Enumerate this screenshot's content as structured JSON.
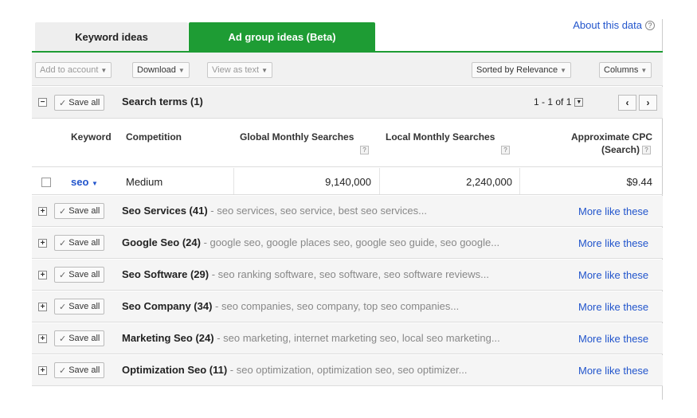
{
  "tabs": [
    {
      "label": "Keyword ideas"
    },
    {
      "label": "Ad group ideas (Beta)"
    }
  ],
  "about": {
    "label": "About this data",
    "help": "?"
  },
  "toolbar": {
    "add_to_account": "Add to account",
    "download": "Download",
    "view_as_text": "View as text",
    "sorted_by": "Sorted by Relevance",
    "columns": "Columns"
  },
  "search_terms": {
    "expander": "−",
    "save_all": "Save all",
    "title": "Search terms (1)",
    "pager": "1 - 1 of 1",
    "prev": "‹",
    "next": "›"
  },
  "columns": {
    "keyword": "Keyword",
    "competition": "Competition",
    "global": "Global Monthly Searches",
    "local": "Local Monthly Searches",
    "cpc_line1": "Approximate CPC",
    "cpc_line2": "(Search)",
    "help": "?"
  },
  "row": {
    "keyword": "seo",
    "competition": "Medium",
    "global": "9,140,000",
    "local": "2,240,000",
    "cpc": "$9.44"
  },
  "groups": [
    {
      "name": "Seo Services (41)",
      "desc": " - seo services, seo service, best seo services...",
      "more": "More like these"
    },
    {
      "name": "Google Seo (24)",
      "desc": " - google seo, google places seo, google seo guide, seo google...",
      "more": "More like these"
    },
    {
      "name": "Seo Software (29)",
      "desc": " - seo ranking software, seo software, seo software reviews...",
      "more": "More like these"
    },
    {
      "name": "Seo Company (34)",
      "desc": " - seo companies, seo company, top seo companies...",
      "more": "More like these"
    },
    {
      "name": "Marketing Seo (24)",
      "desc": " - seo marketing, internet marketing seo, local seo marketing...",
      "more": "More like these"
    },
    {
      "name": "Optimization Seo (11)",
      "desc": " - seo optimization, optimization seo, seo optimizer...",
      "more": "More like these"
    }
  ],
  "group_save_all": "Save all",
  "group_expander": "+",
  "colors": {
    "accent": "#1e9c34",
    "link": "#2255cc"
  }
}
